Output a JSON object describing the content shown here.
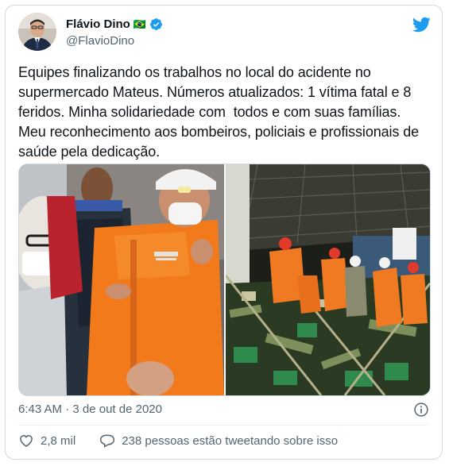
{
  "author": {
    "display_name": "Flávio Dino",
    "flag_emoji": "🇧🇷",
    "handle": "@FlavioDino",
    "verified": true
  },
  "tweet": {
    "text": "Equipes finalizando os trabalhos no local do acidente no supermercado Mateus. Números atualizados: 1 vítima fatal e 8 feridos. Minha solidariedade com  todos e com suas famílias. Meu reconhecimento aos bombeiros, policiais e profissionais de saúde pela dedicação.",
    "timestamp": "6:43 AM · 3 de out de 2020"
  },
  "actions": {
    "likes": "2,8 mil",
    "conversation": "238 pessoas estão tweetando sobre isso"
  },
  "icons": {
    "brand": "twitter-bird-icon",
    "verified": "verified-badge-icon",
    "info": "info-icon",
    "like": "heart-icon",
    "reply": "speech-bubble-icon"
  },
  "colors": {
    "brand_blue": "#1d9bf0",
    "text_primary": "#0f1419",
    "text_secondary": "#536471",
    "border": "#cfd9de"
  }
}
